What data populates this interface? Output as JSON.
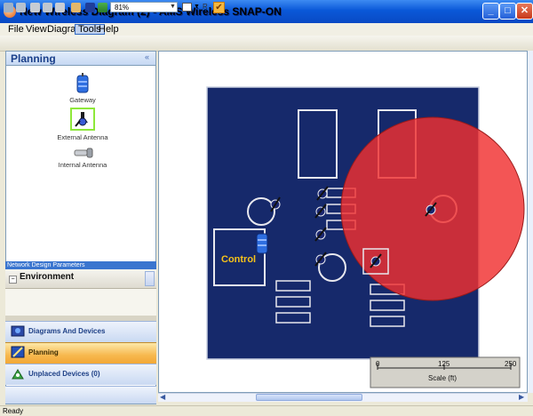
{
  "window": {
    "title": "New Wireless Diagram (2) - AMS Wireless SNAP-ON"
  },
  "menu": {
    "items": [
      "File",
      "View",
      "Diagram",
      "Tools",
      "Help"
    ]
  },
  "toolbar": {
    "zoom": "81%",
    "r_label": "R"
  },
  "left_panel": {
    "title": "Planning",
    "palette": [
      {
        "label": "Gateway",
        "icon": "gateway-icon"
      },
      {
        "label": "External Antenna",
        "icon": "external-antenna-icon"
      },
      {
        "label": "Internal Antenna",
        "icon": "internal-antenna-icon"
      }
    ],
    "network_params_title": "Network Design Parameters",
    "environment_label": "Environment",
    "nav": [
      {
        "label": "Diagrams And Devices",
        "icon": "diagrams-devices-icon"
      },
      {
        "label": "Planning",
        "icon": "planning-icon"
      },
      {
        "label": "Unplaced Devices (0)",
        "icon": "unplaced-devices-icon"
      }
    ]
  },
  "diagram": {
    "area_label": "Control",
    "scale": {
      "ticks": [
        "0",
        "125",
        "250"
      ],
      "label": "Scale (ft)"
    },
    "colors": {
      "floor": "#16296b",
      "outline": "#e8e8ee",
      "range": "#f03030",
      "label": "#f6c21a"
    }
  },
  "status": {
    "text": "Ready"
  }
}
